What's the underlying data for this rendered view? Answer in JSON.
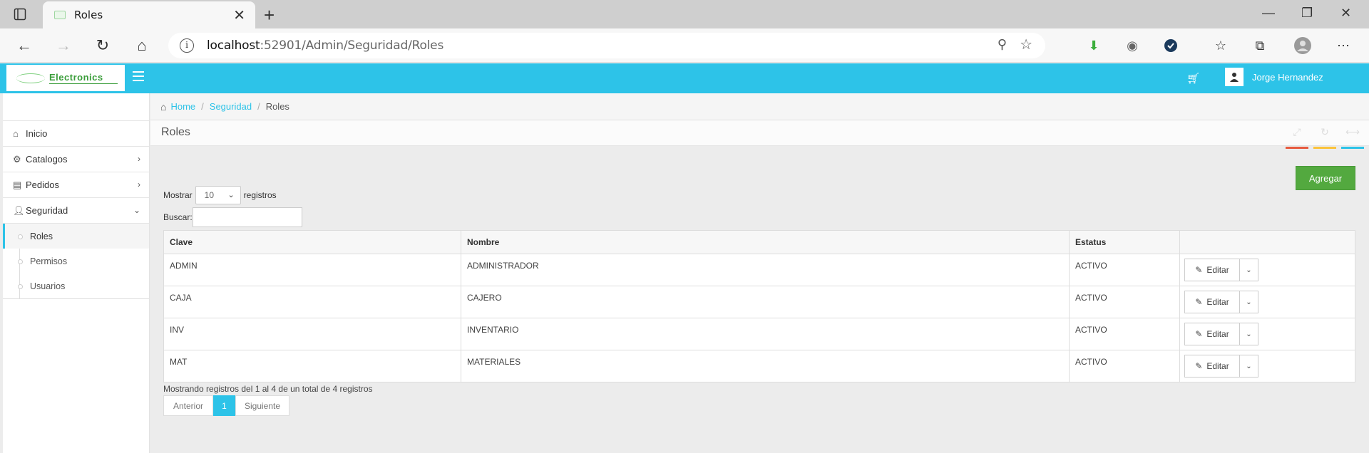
{
  "browser": {
    "tab_title": "Roles",
    "url_host": "localhost",
    "url_path": ":52901/Admin/Seguridad/Roles"
  },
  "header": {
    "logo_text": "Electronics",
    "username": "Jorge Hernandez"
  },
  "sidebar": {
    "items": [
      {
        "label": "Inicio",
        "icon": "home-icon"
      },
      {
        "label": "Catalogos",
        "icon": "cogs-icon"
      },
      {
        "label": "Pedidos",
        "icon": "list-icon"
      },
      {
        "label": "Seguridad",
        "icon": "user-icon"
      }
    ],
    "subitems": [
      "Roles",
      "Permisos",
      "Usuarios"
    ]
  },
  "breadcrumb": {
    "home": "Home",
    "section": "Seguridad",
    "current": "Roles"
  },
  "page": {
    "title": "Roles",
    "add_label": "Agregar"
  },
  "datatable": {
    "show_prefix": "Mostrar",
    "show_value": "10",
    "show_suffix": "registros",
    "search_label": "Buscar:",
    "columns": [
      "Clave",
      "Nombre",
      "Estatus",
      ""
    ],
    "rows": [
      {
        "clave": "ADMIN",
        "nombre": "ADMINISTRADOR",
        "estatus": "ACTIVO"
      },
      {
        "clave": "CAJA",
        "nombre": "CAJERO",
        "estatus": "ACTIVO"
      },
      {
        "clave": "INV",
        "nombre": "INVENTARIO",
        "estatus": "ACTIVO"
      },
      {
        "clave": "MAT",
        "nombre": "MATERIALES",
        "estatus": "ACTIVO"
      }
    ],
    "edit_label": "Editar",
    "info": "Mostrando registros del 1 al 4 de un total de 4 registros",
    "prev": "Anterior",
    "page": "1",
    "next": "Siguiente"
  },
  "colors": {
    "accent": "#2dc3e8",
    "success": "#53a93f"
  }
}
